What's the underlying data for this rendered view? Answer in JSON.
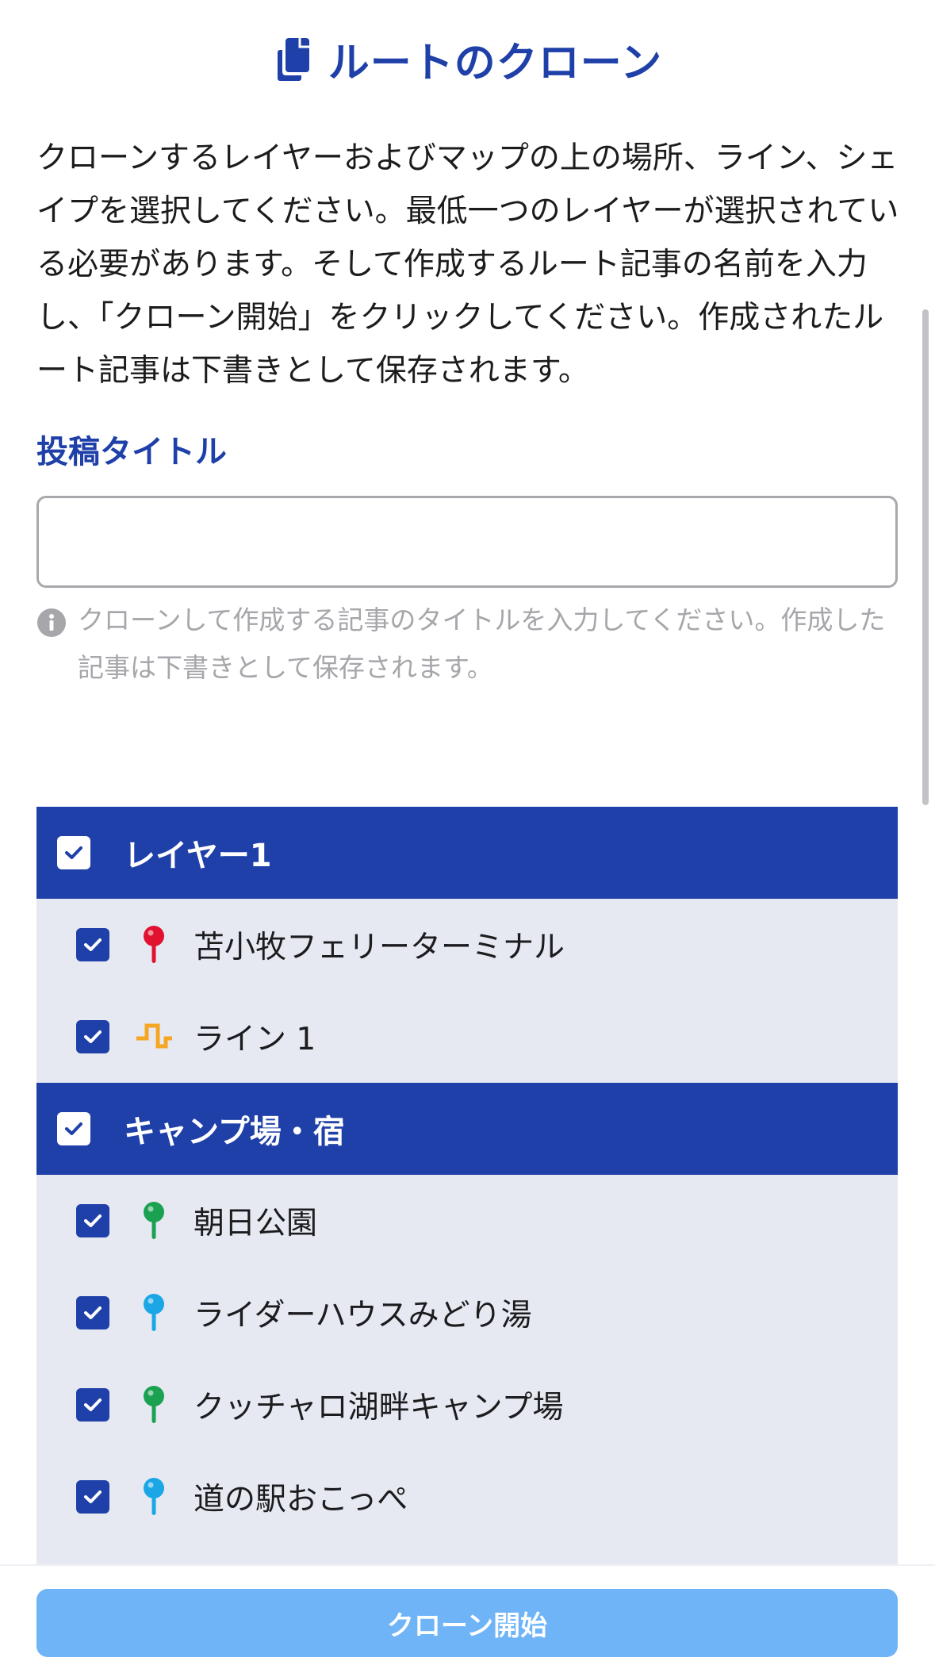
{
  "header": {
    "title": "ルートのクローン",
    "icon": "copy-icon"
  },
  "description": "クローンするレイヤーおよびマップの上の場所、ライン、シェイプを選択してください。最低一つのレイヤーが選択されている必要があります。そして作成するルート記事の名前を入力し、「クローン開始」をクリックしてください。作成されたルート記事は下書きとして保存されます。",
  "post_title": {
    "label": "投稿タイトル",
    "value": "",
    "placeholder": "",
    "help_icon": "info-icon",
    "help_text": "クローンして作成する記事のタイトルを入力してください。作成した記事は下書きとして保存されます。"
  },
  "layers": [
    {
      "name": "レイヤー1",
      "checked": true,
      "items": [
        {
          "label": "苫小牧フェリーターミナル",
          "type": "place",
          "icon": "map-pin-icon",
          "color": "#e0122f",
          "checked": true
        },
        {
          "label": "ライン 1",
          "type": "line",
          "icon": "line-icon",
          "color": "#f5a623",
          "checked": true
        }
      ]
    },
    {
      "name": "キャンプ場・宿",
      "checked": true,
      "items": [
        {
          "label": "朝日公園",
          "type": "place",
          "icon": "map-pin-icon",
          "color": "#1aa152",
          "checked": true
        },
        {
          "label": "ライダーハウスみどり湯",
          "type": "place",
          "icon": "map-pin-icon",
          "color": "#1ba7e6",
          "checked": true
        },
        {
          "label": "クッチャロ湖畔キャンプ場",
          "type": "place",
          "icon": "map-pin-icon",
          "color": "#1aa152",
          "checked": true
        },
        {
          "label": "道の駅おこっぺ",
          "type": "place",
          "icon": "map-pin-icon",
          "color": "#1ba7e6",
          "checked": true
        }
      ]
    }
  ],
  "footer": {
    "button_label": "クローン開始"
  },
  "colors": {
    "accent": "#1e40a8",
    "list_background": "#e6e9f2",
    "button": "#6eb4f7"
  }
}
